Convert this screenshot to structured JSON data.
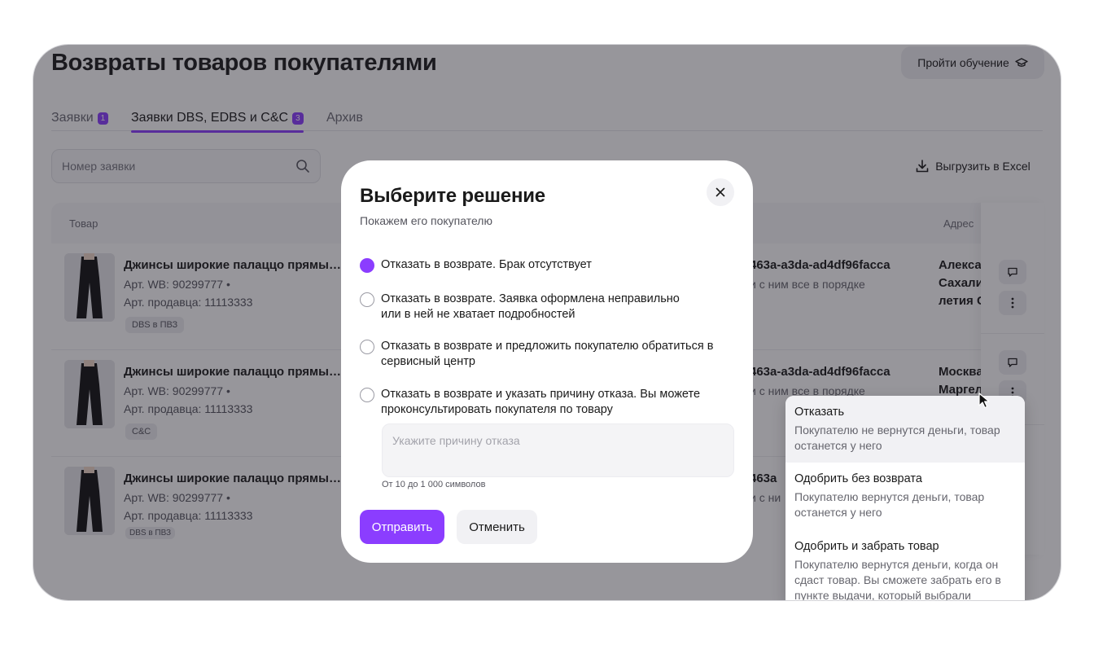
{
  "page": {
    "title": "Возвраты товаров покупателями",
    "training_button": "Пройти обучение",
    "tabs": [
      {
        "label": "Заявки",
        "badge": "1"
      },
      {
        "label": "Заявки DBS, EDBS и C&C",
        "badge": "3"
      },
      {
        "label": "Архив",
        "badge": ""
      }
    ],
    "search_placeholder": "Номер заявки",
    "export_button": "Выгрузить в Excel"
  },
  "table": {
    "columns": {
      "product": "Товар",
      "address": "Адрес"
    },
    "rows": [
      {
        "name": "Джинсы широкие палаццо прямые...",
        "wb_article": "Арт. WB: 90299777 •",
        "seller_article": "Арт. продавца: 11113333",
        "chip": "DBS в ПВЗ",
        "request_id": "463a-a3da-ad4df96facca",
        "note": "и с ним все в порядке",
        "address_lines": [
          "Алекса",
          "Сахали",
          "летия С"
        ]
      },
      {
        "name": "Джинсы широкие палаццо прямые...",
        "wb_article": "Арт. WB: 90299777 •",
        "seller_article": "Арт. продавца: 11113333",
        "chip": "C&C",
        "request_id": "463a-a3da-ad4df96facca",
        "note": "и с ним все в порядке",
        "address_lines": [
          "Москва",
          "Маргел"
        ]
      },
      {
        "name": "Джинсы широкие палаццо прямые...",
        "wb_article": "Арт. WB: 90299777 •",
        "seller_article": "Арт. продавца: 11113333",
        "chip": "DBS в ПВЗ",
        "request_id": "463a",
        "note": "и с ни",
        "address_lines": []
      }
    ]
  },
  "modal": {
    "title": "Выберите решение",
    "subtitle": "Покажем его покупателю",
    "options": [
      {
        "label": "Отказать в возврате. Брак отсутствует",
        "checked": true
      },
      {
        "label": "Отказать в возврате. Заявка оформлена неправильно или в ней не хватает подробностей",
        "checked": false
      },
      {
        "label": "Отказать в возврате и предложить покупателю обратиться в сервисный центр",
        "checked": false
      },
      {
        "label": "Отказать в возврате и указать причину отказа. Вы можете проконсультировать покупателя по товару",
        "checked": false
      }
    ],
    "reason_placeholder": "Укажите причину отказа",
    "reason_hint": "От 10 до 1 000 символов",
    "submit_button": "Отправить",
    "cancel_button": "Отменить"
  },
  "dropdown": {
    "items": [
      {
        "title": "Отказать",
        "description": "Покупателю не вернутся деньги, товар останется у него"
      },
      {
        "title": "Одобрить без возврата",
        "description": "Покупателю вернутся деньги, товар останется у него"
      },
      {
        "title": "Одобрить и забрать товар",
        "description": "Покупателю вернутся деньги, когда он сдаст товар. Вы сможете забрать его в пункте выдачи, который выбрали"
      }
    ]
  },
  "colors": {
    "accent": "#8b3dff",
    "overlay": "#1c1a24"
  }
}
